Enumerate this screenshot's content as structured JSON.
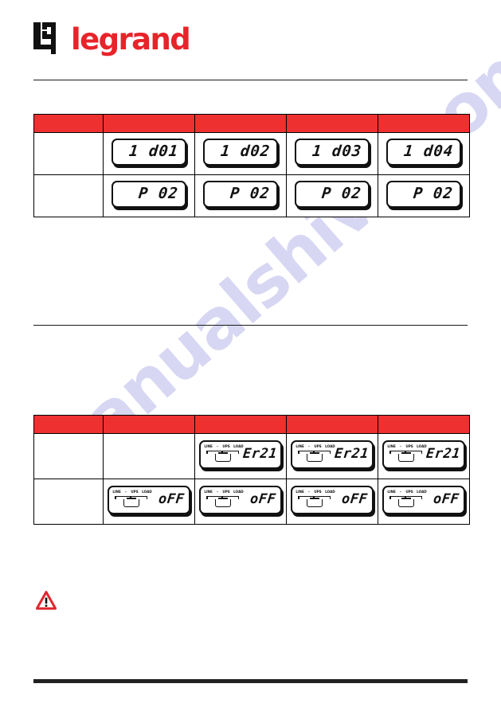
{
  "document": {
    "brand": "legrand",
    "brand_color": "#e8232a",
    "accent_red": "#ee3030",
    "watermark_text": "manualshive.com"
  },
  "table_one": {
    "name": "display-code-table",
    "header": {
      "cells": [
        "",
        "",
        "",
        "",
        ""
      ]
    },
    "rows": [
      {
        "label": "",
        "displays": [
          {
            "code": "1 d01",
            "type": "code-display"
          },
          {
            "code": "1 d02",
            "type": "code-display"
          },
          {
            "code": "1 d03",
            "type": "code-display"
          },
          {
            "code": "1 d04",
            "type": "code-display"
          }
        ]
      },
      {
        "label": "",
        "displays": [
          {
            "code": "P 02",
            "type": "code-display"
          },
          {
            "code": "P 02",
            "type": "code-display"
          },
          {
            "code": "P 02",
            "type": "code-display"
          },
          {
            "code": "P 02",
            "type": "code-display"
          }
        ]
      }
    ]
  },
  "table_two": {
    "name": "status-display-table",
    "header": {
      "cells": [
        "",
        "",
        "",
        "",
        ""
      ]
    },
    "flow_labels": {
      "line": "LINE",
      "dash": "–",
      "ups": "UPS",
      "load": "LOAD"
    },
    "rows": [
      {
        "label": "",
        "displays": [
          {
            "code": "",
            "type": "empty"
          },
          {
            "code": "Er21",
            "type": "status-display"
          },
          {
            "code": "Er21",
            "type": "status-display"
          },
          {
            "code": "Er21",
            "type": "status-display"
          }
        ]
      },
      {
        "label": "",
        "displays": [
          {
            "code": "oFF",
            "type": "status-display"
          },
          {
            "code": "oFF",
            "type": "status-display"
          },
          {
            "code": "oFF",
            "type": "status-display"
          },
          {
            "code": "oFF",
            "type": "status-display"
          }
        ]
      }
    ]
  },
  "notice": {
    "icon": "warning-triangle-icon",
    "icon_color": "#e0262e",
    "text": ""
  }
}
